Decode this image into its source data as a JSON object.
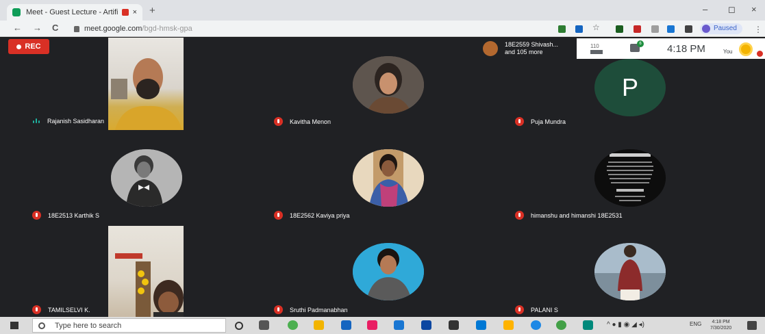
{
  "browser": {
    "tab_title": "Meet - Guest Lecture - Artifi",
    "tab_close": "×",
    "new_tab": "+",
    "url_host": "meet.google.com",
    "url_path": "/bgd-hmsk-gpa",
    "paused_label": "Paused",
    "nav_back": "←",
    "nav_forward": "→",
    "nav_reload": "C",
    "star": "☆",
    "menu": "⋮",
    "minimize": "–",
    "maximize": "◻",
    "close": "×"
  },
  "meet": {
    "rec_label": "REC",
    "viewers_text_line1": "18E2559 Shivash...",
    "viewers_text_line2": "and 105 more",
    "people_count": "110",
    "chat_badge": "6",
    "time": "4:18 PM",
    "you_label": "You",
    "participants": [
      {
        "name": "Rajanish Sasidharan",
        "state": "speaking"
      },
      {
        "name": "Kavitha Menon",
        "state": "muted"
      },
      {
        "name": "Puja Mundra",
        "state": "muted",
        "initial": "P"
      },
      {
        "name": "18E2513 Karthik S",
        "state": "muted"
      },
      {
        "name": "18E2562 Kaviya priya",
        "state": "muted"
      },
      {
        "name": "himanshu and himanshi 18E2531",
        "state": "muted"
      },
      {
        "name": "TAMILSELVI K.",
        "state": "muted"
      },
      {
        "name": "Sruthi Padmanabhan",
        "state": "muted"
      },
      {
        "name": "PALANI S",
        "state": "muted"
      }
    ]
  },
  "taskbar": {
    "search_placeholder": "Type here to search",
    "tray_lang": "ENG",
    "clock_time": "4:18 PM",
    "clock_date": "7/30/2020"
  },
  "colors": {
    "meet_bg": "#202124",
    "rec_red": "#d93025",
    "mic_muted": "#d93025",
    "speaking": "#1fb3a1",
    "puja_avatar": "#1e4d3a"
  },
  "icons": [
    "back-arrow-icon",
    "forward-arrow-icon",
    "reload-icon",
    "lock-icon",
    "star-icon",
    "people-icon",
    "chat-icon",
    "mic-off-icon",
    "speaking-icon",
    "windows-start-icon",
    "search-icon"
  ]
}
